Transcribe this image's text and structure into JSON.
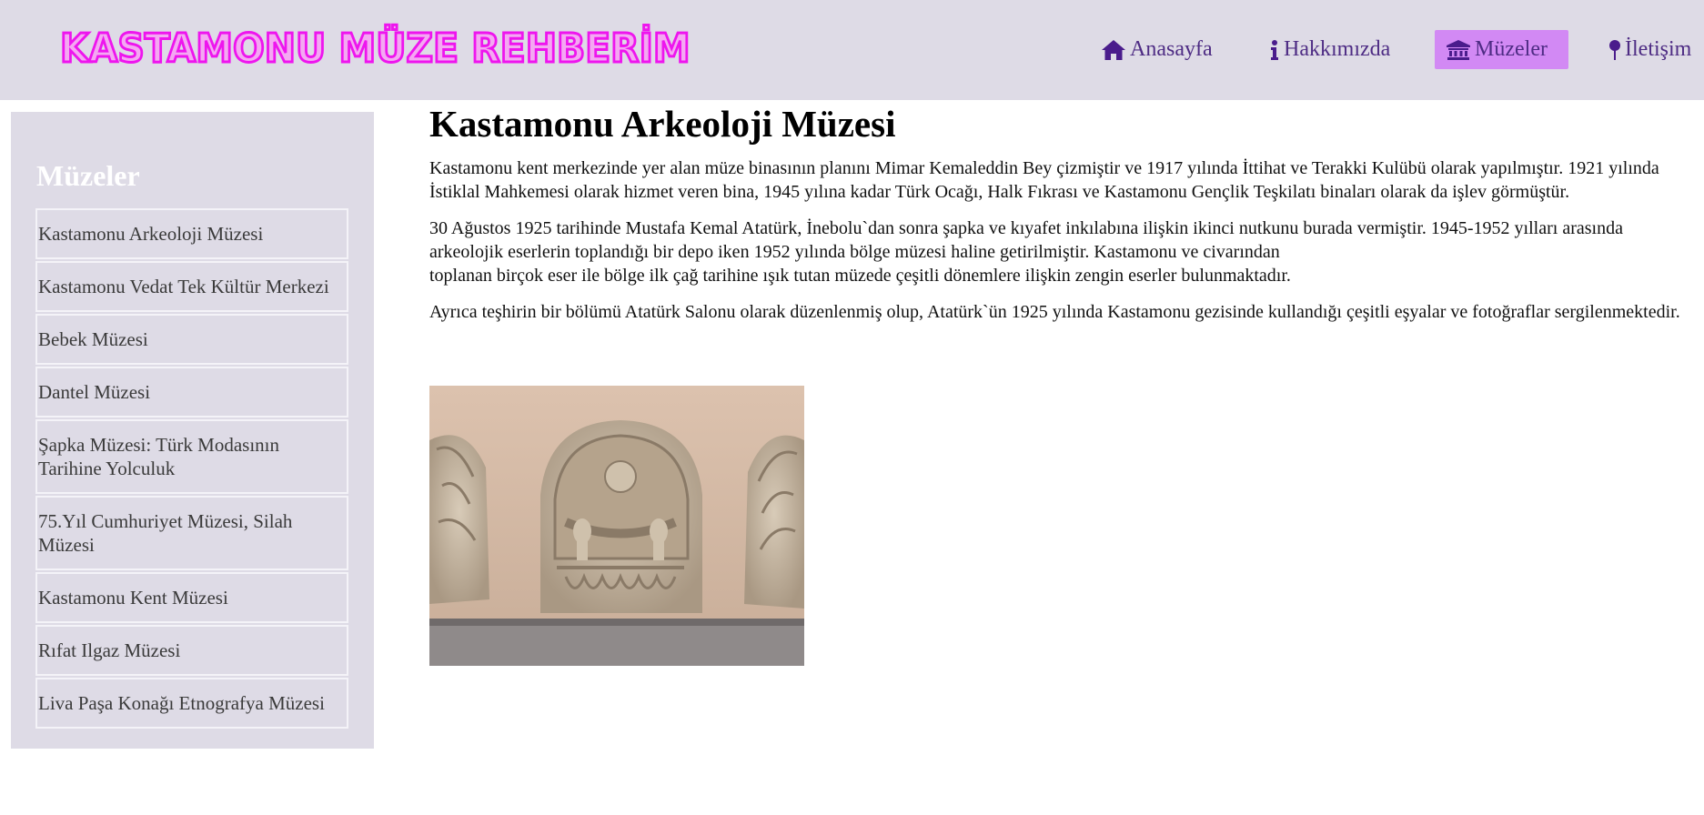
{
  "header": {
    "logo_text": "KASTAMONU MÜZE REHBERİM",
    "nav": [
      {
        "label": "Anasayfa",
        "icon": "home-icon",
        "active": false
      },
      {
        "label": "Hakkımızda",
        "icon": "info-icon",
        "active": false
      },
      {
        "label": "Müzeler",
        "icon": "museum-icon",
        "active": true
      },
      {
        "label": "İletişim",
        "icon": "map-pin-icon",
        "active": false
      }
    ]
  },
  "sidebar": {
    "title": "Müzeler",
    "items": [
      "Kastamonu Arkeoloji Müzesi",
      "Kastamonu Vedat Tek Kültür Merkezi",
      "Bebek Müzesi",
      "Dantel Müzesi",
      "Şapka Müzesi: Türk Modasının Tarihine Yolculuk",
      "75.Yıl Cumhuriyet Müzesi, Silah Müzesi",
      "Kastamonu Kent Müzesi",
      "Rıfat Ilgaz Müzesi",
      "Liva Paşa Konağı Etnografya Müzesi"
    ]
  },
  "main": {
    "title": "Kastamonu Arkeoloji Müzesi",
    "paragraph_1": "Kastamonu kent merkezinde yer alan müze binasının planını Mimar Kemaleddin Bey çizmiştir ve 1917 yılında İttihat ve Terakki Kulübü olarak yapılmıştır. 1921 yılında İstiklal Mahkemesi olarak hizmet veren bina, 1945 yılına kadar Türk Ocağı, Halk Fıkrası ve Kastamonu Gençlik Teşkilatı binaları olarak da işlev görmüştür.",
    "paragraph_2a": "30 Ağustos 1925 tarihinde Mustafa Kemal Atatürk, İnebolu`dan sonra şapka ve kıyafet inkılabına ilişkin ikinci nutkunu burada vermiştir. 1945-1952 yılları arasında arkeolojik eserlerin toplandığı bir depo iken 1952 yılında bölge müzesi haline getirilmiştir. Kastamonu ve civarından",
    "paragraph_2b": "toplanan birçok eser ile bölge ilk çağ tarihine ışık tutan müzede çeşitli dönemlere ilişkin zengin eserler bulunmaktadır.",
    "paragraph_3": "Ayrıca teşhirin bir bölümü Atatürk Salonu olarak düzenlenmiş olup, Atatürk`ün 1925 yılında Kastamonu gezisinde kullandığı çeşitli eşyalar ve fotoğraflar sergilenmektedir."
  },
  "colors": {
    "header_bg": "#dedbe6",
    "active_nav": "#d289f4",
    "nav_text": "#4e2c84",
    "logo_stroke": "#ee15ee"
  }
}
